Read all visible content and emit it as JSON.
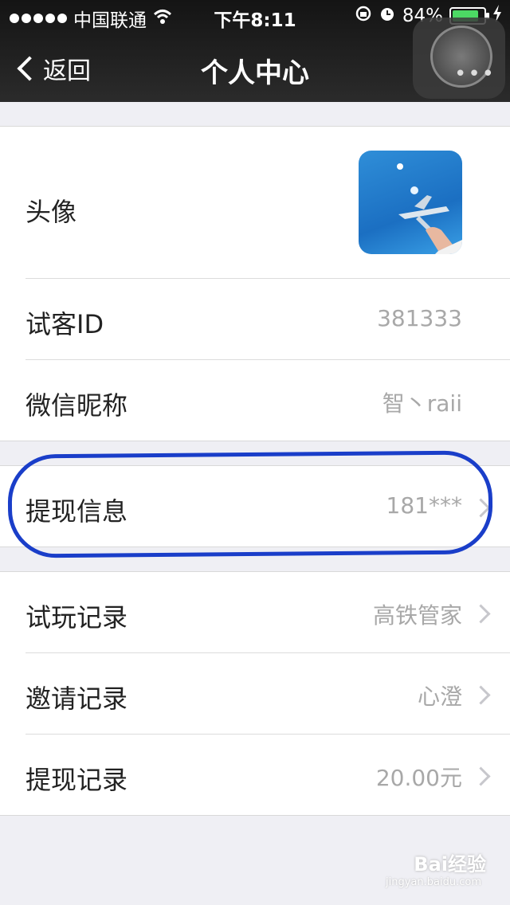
{
  "status_bar": {
    "carrier": "中国联通",
    "time": "下午8:11",
    "battery": "84%",
    "battery_level": 0.84
  },
  "nav": {
    "back_label": "返回",
    "title": "个人中心"
  },
  "profile": {
    "avatar_label": "头像",
    "guest_id_label": "试客ID",
    "guest_id_value": "381333",
    "wechat_name_label": "微信昵称",
    "wechat_name_value": "智丶raii"
  },
  "withdraw_info": {
    "label": "提现信息",
    "value": "181***"
  },
  "records": [
    {
      "label": "试玩记录",
      "value": "高铁管家"
    },
    {
      "label": "邀请记录",
      "value": "心澄"
    },
    {
      "label": "提现记录",
      "value": "20.00元"
    }
  ],
  "watermark": {
    "brand": "Bai经验",
    "url": "jingyan.baidu.com"
  }
}
